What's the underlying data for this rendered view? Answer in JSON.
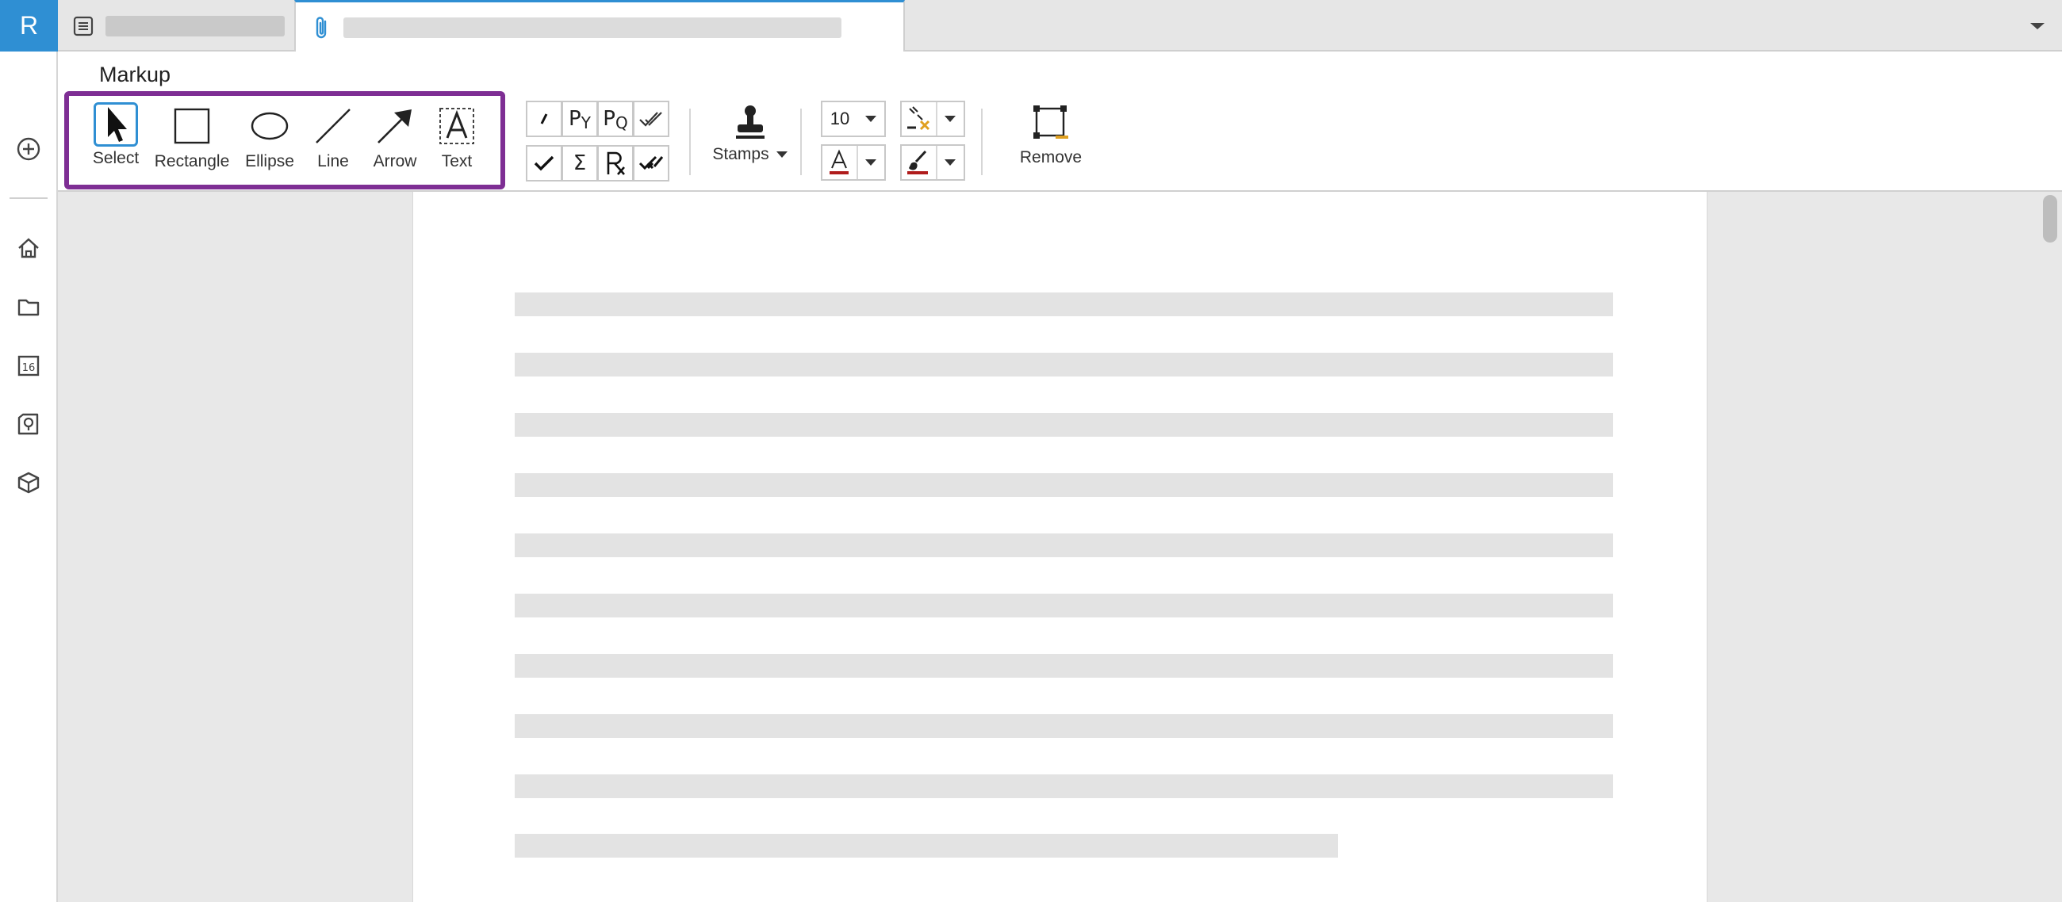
{
  "app": {
    "logo_letter": "R"
  },
  "rail": {
    "items": [
      {
        "name": "add",
        "icon": "plus-circle-icon"
      },
      {
        "name": "home",
        "icon": "home-icon"
      },
      {
        "name": "files",
        "icon": "folder-icon"
      },
      {
        "name": "calendar",
        "icon": "calendar-icon",
        "badge": "16"
      },
      {
        "name": "ideas",
        "icon": "lightbulb-icon"
      },
      {
        "name": "models",
        "icon": "cube-icon"
      }
    ]
  },
  "tabs": [
    {
      "icon": "list-icon",
      "title": ""
    },
    {
      "icon": "paperclip-icon",
      "title": "",
      "active": true
    }
  ],
  "ribbon": {
    "title": "Markup",
    "tools": [
      {
        "label": "Select",
        "icon": "cursor-icon",
        "selected": true
      },
      {
        "label": "Rectangle",
        "icon": "rectangle-icon"
      },
      {
        "label": "Ellipse",
        "icon": "ellipse-icon"
      },
      {
        "label": "Line",
        "icon": "line-icon"
      },
      {
        "label": "Arrow",
        "icon": "arrow-icon"
      },
      {
        "label": "Text",
        "icon": "text-box-icon"
      }
    ],
    "quick_marks": {
      "row1": [
        "tick-mark",
        "P Y",
        "P Q",
        "double-check"
      ],
      "row2": [
        "check",
        "Σ",
        "Rx",
        "double-cross-check"
      ],
      "glyphs": {
        "py": "P",
        "py_sub": "Y",
        "pq": "P",
        "pq_sub": "Q",
        "sigma": "Σ"
      }
    },
    "stamps_label": "Stamps",
    "font_size_value": "10",
    "text_color": "#b01c1c",
    "highlight_color": "#b01c1c",
    "remove_label": "Remove",
    "accent_color": "#2f8fd3",
    "highlight_box_color": "#7e2e94"
  }
}
